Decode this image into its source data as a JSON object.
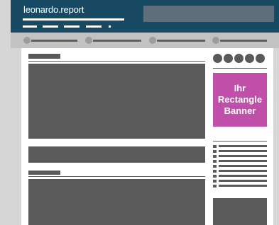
{
  "header": {
    "logo_text": "leonardo.report",
    "bg_color": "#184a63"
  },
  "sidebar": {
    "banner_lines": [
      "Ihr",
      "Rectangle",
      "Banner"
    ],
    "banner_color": "#bf4fa8"
  }
}
